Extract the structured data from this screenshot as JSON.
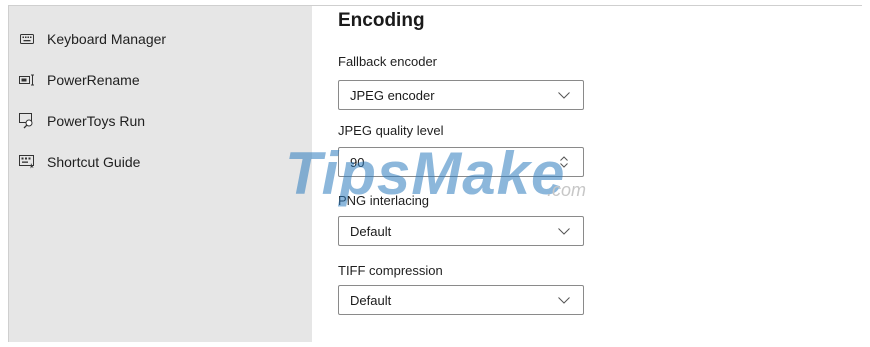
{
  "sidebar": {
    "items": [
      {
        "label": "Keyboard Manager",
        "icon": "keyboard-icon"
      },
      {
        "label": "PowerRename",
        "icon": "rename-icon"
      },
      {
        "label": "PowerToys Run",
        "icon": "run-icon"
      },
      {
        "label": "Shortcut Guide",
        "icon": "shortcut-guide-icon"
      }
    ]
  },
  "encoding": {
    "title": "Encoding",
    "fallback_encoder": {
      "label": "Fallback encoder",
      "value": "JPEG encoder"
    },
    "jpeg_quality": {
      "label": "JPEG quality level",
      "value": "90"
    },
    "png_interlacing": {
      "label": "PNG interlacing",
      "value": "Default"
    },
    "tiff_compression": {
      "label": "TIFF compression",
      "value": "Default"
    }
  },
  "watermark": {
    "main": "TipsMake",
    "suffix": ".com"
  },
  "colors": {
    "sidebar_bg": "#e6e6e6",
    "border": "#8a8a8a",
    "watermark": "#2f7dbf"
  }
}
